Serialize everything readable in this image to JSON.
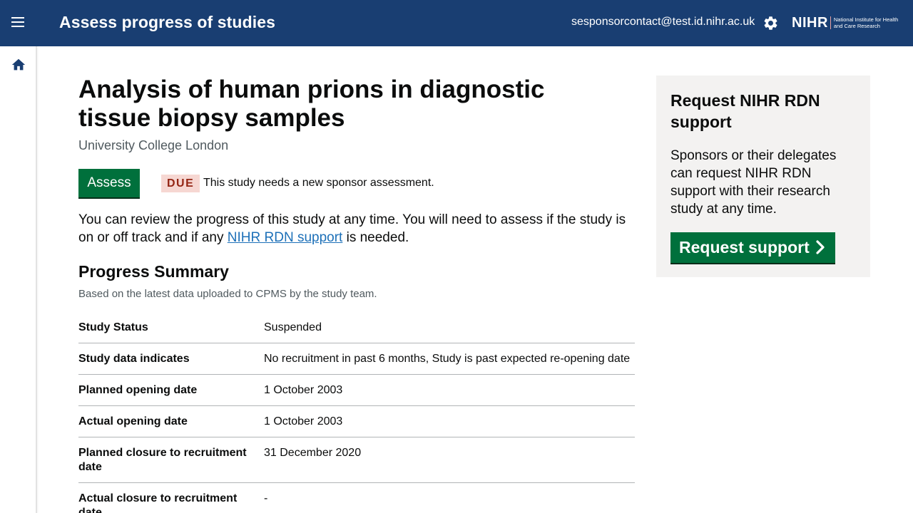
{
  "header": {
    "title": "Assess progress of studies",
    "user_email": "sesponsorcontact@test.id.nihr.ac.uk",
    "logo_main": "NIHR",
    "logo_sub": "National Institute for Health and Care Research",
    "menu_icon": "hamburger-menu-icon",
    "settings_icon": "gear-icon"
  },
  "sidebar": {
    "home_icon": "home-icon"
  },
  "study": {
    "title": "Analysis of human prions in diagnostic tissue biopsy samples",
    "organisation": "University College London"
  },
  "assessment": {
    "button_label": "Assess",
    "status_tag": "DUE",
    "status_text": "This study needs a new sponsor assessment."
  },
  "intro": {
    "text_before": "You can review the progress of this study at any time. You will need to assess if the study is on or off track and if any ",
    "link_text": "NIHR RDN support",
    "text_after": " is needed."
  },
  "progress_summary": {
    "title": "Progress Summary",
    "description": "Based on the latest data uploaded to CPMS by the study team.",
    "rows": [
      {
        "key": "Study Status",
        "value": "Suspended"
      },
      {
        "key": "Study data indicates",
        "value": "No recruitment in past 6 months, Study is past expected re-opening date"
      },
      {
        "key": "Planned opening date",
        "value": "1 October 2003"
      },
      {
        "key": "Actual opening date",
        "value": "1 October 2003"
      },
      {
        "key": "Planned closure to recruitment date",
        "value": "31 December 2020"
      },
      {
        "key": "Actual closure to recruitment date",
        "value": "-"
      }
    ]
  },
  "support_panel": {
    "title": "Request NIHR RDN support",
    "text": "Sponsors or their delegates can request NIHR RDN support with their research study at any time.",
    "button_label": "Request support",
    "button_icon": "chevron-right-icon"
  },
  "colors": {
    "header_bg": "#193e72",
    "primary_button": "#00703c",
    "due_tag_bg": "#f6d7d2",
    "due_tag_text": "#942514",
    "link": "#1d70b8",
    "panel_bg": "#f3f2f1"
  }
}
